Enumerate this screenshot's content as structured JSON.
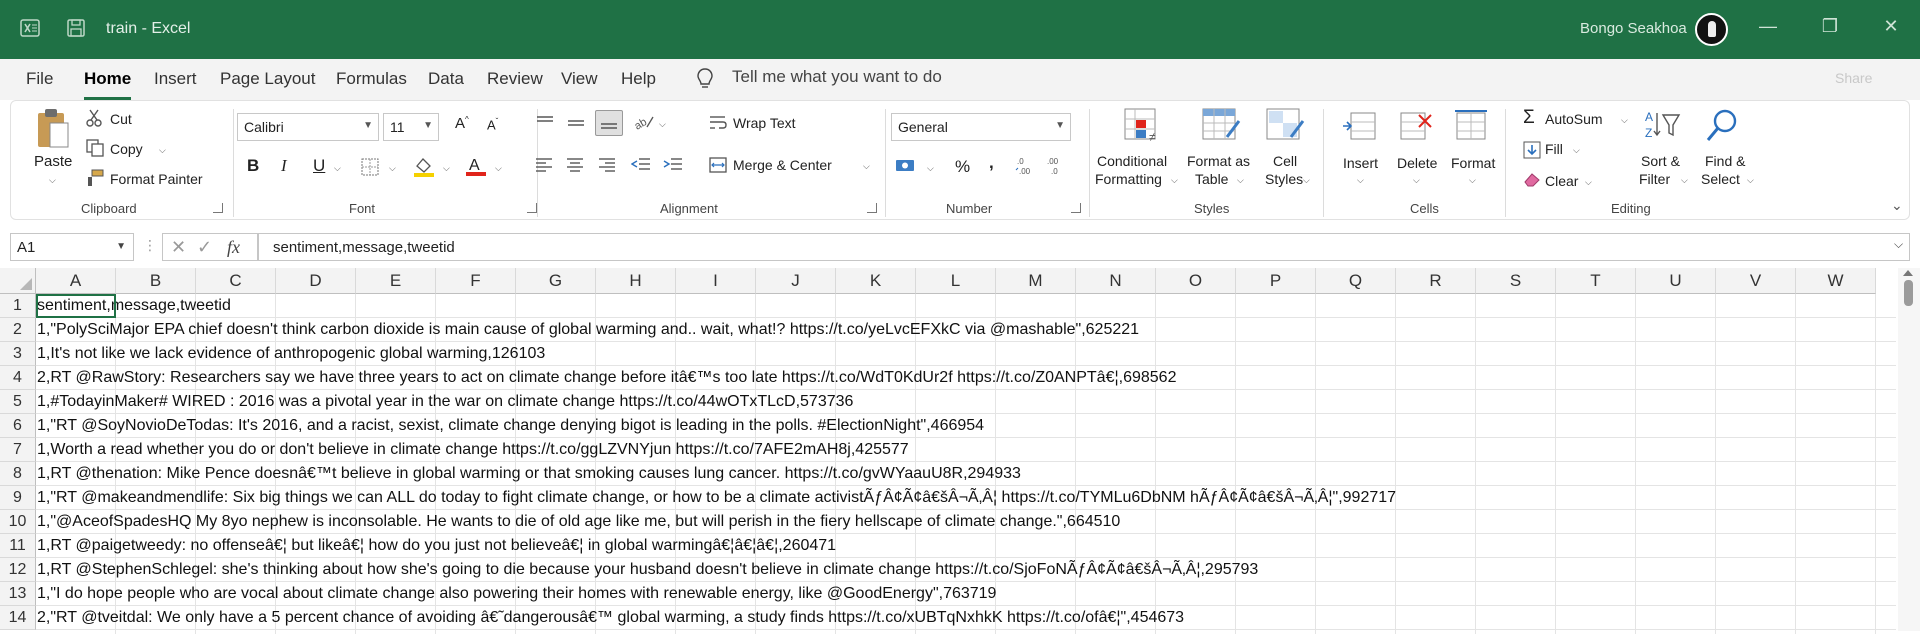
{
  "window": {
    "title": "train  -  Excel",
    "user": "Bongo Seakhoa",
    "brand_color": "#1f7145"
  },
  "menu": {
    "tabs": [
      "File",
      "Home",
      "Insert",
      "Page Layout",
      "Formulas",
      "Data",
      "Review",
      "View",
      "Help"
    ],
    "active_tab": "Home",
    "tell_me": "Tell me what you want to do",
    "share": "Share"
  },
  "ribbon": {
    "clipboard": {
      "paste": "Paste",
      "cut": "Cut",
      "copy": "Copy",
      "format_painter": "Format Painter",
      "label": "Clipboard"
    },
    "font": {
      "family": "Calibri",
      "size": "11",
      "bold": "B",
      "italic": "I",
      "underline": "U",
      "label": "Font",
      "fill_color": "#f5d100",
      "font_color": "#e0241b"
    },
    "alignment": {
      "wrap_text": "Wrap Text",
      "merge_center": "Merge & Center",
      "label": "Alignment"
    },
    "number": {
      "format": "General",
      "percent": "%",
      "comma": ",",
      "label": "Number"
    },
    "styles": {
      "conditional": "Conditional",
      "formatting": "Formatting",
      "format_as": "Format as",
      "table": "Table",
      "cell": "Cell",
      "styles": "Styles",
      "label": "Styles"
    },
    "cells": {
      "insert": "Insert",
      "delete": "Delete",
      "format": "Format",
      "label": "Cells"
    },
    "editing": {
      "autosum": "AutoSum",
      "fill": "Fill",
      "clear": "Clear",
      "sort": "Sort &",
      "filter": "Filter",
      "find": "Find &",
      "select": "Select",
      "label": "Editing"
    }
  },
  "formula_bar": {
    "name_box": "A1",
    "fx": "fx",
    "content": "sentiment,message,tweetid"
  },
  "sheet": {
    "columns": [
      "A",
      "B",
      "C",
      "D",
      "E",
      "F",
      "G",
      "H",
      "I",
      "J",
      "K",
      "L",
      "M",
      "N",
      "O",
      "P",
      "Q",
      "R",
      "S",
      "T",
      "U",
      "V",
      "W"
    ],
    "rows": [
      {
        "n": "1",
        "text": "sentiment,message,tweetid"
      },
      {
        "n": "2",
        "text": "1,\"PolySciMajor EPA chief doesn't think carbon dioxide is main cause of global warming and.. wait, what!? https://t.co/yeLvcEFXkC via @mashable\",625221"
      },
      {
        "n": "3",
        "text": "1,It's not like we lack evidence of anthropogenic global warming,126103"
      },
      {
        "n": "4",
        "text": "2,RT @RawStory: Researchers say we have three years to act on climate change before itâ€™s too late https://t.co/WdT0KdUr2f https://t.co/Z0ANPTâ€¦,698562"
      },
      {
        "n": "5",
        "text": "1,#TodayinMaker# WIRED : 2016 was a pivotal year in the war on climate change https://t.co/44wOTxTLcD,573736"
      },
      {
        "n": "6",
        "text": "1,\"RT @SoyNovioDeTodas: It's 2016, and a racist, sexist, climate change denying bigot is leading in the polls. #ElectionNight\",466954"
      },
      {
        "n": "7",
        "text": "1,Worth a read whether you do or don't believe in climate change https://t.co/ggLZVNYjun https://t.co/7AFE2mAH8j,425577"
      },
      {
        "n": "8",
        "text": "1,RT @thenation: Mike Pence doesnâ€™t believe in global warming or that smoking causes lung cancer. https://t.co/gvWYaauU8R,294933"
      },
      {
        "n": "9",
        "text": "1,\"RT @makeandmendlife: Six big things we can ALL do today to fight climate change, or how to be a climate activistÃƒÂ¢Ã¢â€šÂ¬Ã‚Â¦ https://t.co/TYMLu6DbNM hÃƒÂ¢Ã¢â€šÂ¬Ã‚Â¦\",992717"
      },
      {
        "n": "10",
        "text": "1,\"@AceofSpadesHQ My 8yo nephew is inconsolable. He wants to die of old age like me, but will perish in the fiery hellscape of climate change.\",664510"
      },
      {
        "n": "11",
        "text": "1,RT @paigetweedy: no offenseâ€¦ but likeâ€¦ how do you just not believeâ€¦ in global warmingâ€¦â€¦â€¦,260471"
      },
      {
        "n": "12",
        "text": "1,RT @StephenSchlegel: she's thinking about how she's going to die because your husband doesn't believe in climate change https://t.co/SjoFoNÃƒÂ¢Ã¢â€šÂ¬Ã‚Â¦,295793"
      },
      {
        "n": "13",
        "text": "1,\"I do hope people who are vocal about climate change also powering their homes with renewable energy, like @GoodEnergy\",763719"
      },
      {
        "n": "14",
        "text": "2,\"RT @tveitdal: We only have a 5 percent chance of avoiding â€˜dangerousâ€™ global warming, a study finds https://t.co/xUBTqNxhkK https://t.co/ofâ€¦\",454673"
      }
    ]
  }
}
